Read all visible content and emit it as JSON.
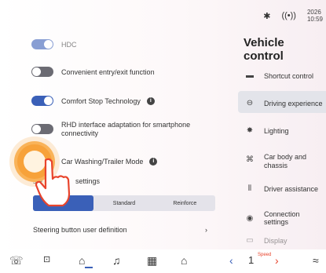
{
  "status": {
    "bluetooth_icon": "bluetooth-icon",
    "signal_icon": "signal-icon",
    "date": "2026",
    "time": "10:59"
  },
  "title": "Vehicle control",
  "settings": {
    "top_partial": "HDC",
    "items": [
      {
        "label": "Convenient entry/exit function",
        "state": "off"
      },
      {
        "label": "Comfort Stop Technology",
        "state": "on",
        "info": true
      },
      {
        "label": "RHD interface adaptation for smartphone connectivity",
        "state": "off"
      },
      {
        "label": "Car Washing/Trailer Mode",
        "state": "on",
        "info": true
      }
    ],
    "steering_label": "Steering settings",
    "steering_visible_prefix": "ste",
    "steering_visible_suffix": "settings",
    "modes": [
      "",
      "Standard",
      "Reinforce"
    ],
    "button_def": "Steering button user definition"
  },
  "menu": [
    {
      "label": "Shortcut control",
      "icon": "car-icon"
    },
    {
      "label": "Driving experience",
      "icon": "steering-wheel-icon",
      "selected": true
    },
    {
      "label": "Lighting",
      "icon": "light-icon"
    },
    {
      "label": "Car body and chassis",
      "icon": "car-body-icon"
    },
    {
      "label": "Driver assistance",
      "icon": "driver-assist-icon"
    },
    {
      "label": "Connection settings",
      "icon": "connection-icon"
    },
    {
      "label": "Display",
      "icon": "display-icon"
    }
  ],
  "bottom": {
    "speed": "1",
    "speed_label": "Speed"
  },
  "accent": "#3a60b8"
}
